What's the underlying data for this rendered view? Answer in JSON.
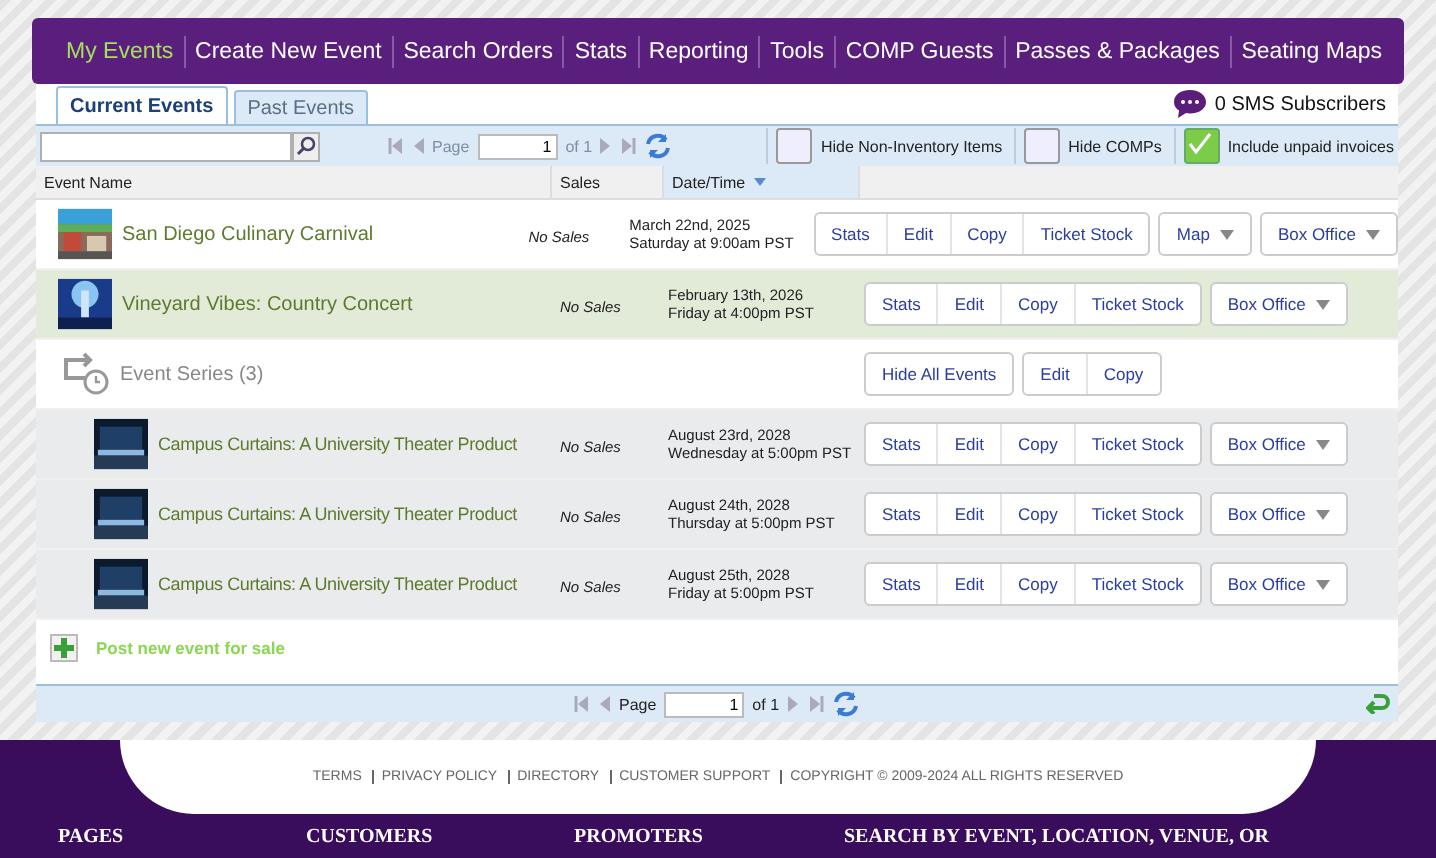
{
  "nav": [
    {
      "label": "My Events",
      "selected": true
    },
    {
      "label": "Create New Event",
      "selected": false
    },
    {
      "label": "Search Orders",
      "selected": false
    },
    {
      "label": "Stats",
      "selected": false
    },
    {
      "label": "Reporting",
      "selected": false
    },
    {
      "label": "Tools",
      "selected": false
    },
    {
      "label": "COMP Guests",
      "selected": false
    },
    {
      "label": "Passes & Packages",
      "selected": false
    },
    {
      "label": "Seating Maps",
      "selected": false
    }
  ],
  "tabs": [
    {
      "label": "Current Events",
      "selected": true
    },
    {
      "label": "Past Events",
      "selected": false
    }
  ],
  "sms": "0 SMS Subscribers",
  "toolbar": {
    "page_label": "Page",
    "page_value": "1",
    "page_of": "of 1",
    "options": [
      {
        "label": "Hide Non-Inventory Items",
        "checked": false
      },
      {
        "label": "Hide COMPs",
        "checked": false
      },
      {
        "label": "Include unpaid invoices",
        "checked": true
      }
    ]
  },
  "columns": [
    "Event Name",
    "Sales",
    "Date/Time"
  ],
  "rows": [
    {
      "kind": "event",
      "name": "San Diego Culinary Carnival",
      "sales": "No Sales",
      "date": "March 22nd, 2025",
      "time": "Saturday at 9:00am PST",
      "highlighted": false,
      "groups": [
        {
          "buttons": [
            "Stats",
            "Edit",
            "Copy",
            "Ticket Stock"
          ],
          "dropdown": false
        },
        {
          "buttons": [
            "Map"
          ],
          "dropdown": true
        },
        {
          "buttons": [
            "Box Office"
          ],
          "dropdown": true
        }
      ]
    },
    {
      "kind": "event",
      "name": "Vineyard Vibes: Country Concert",
      "sales": "No Sales",
      "date": "February 13th, 2026",
      "time": "Friday at 4:00pm PST",
      "highlighted": true,
      "groups": [
        {
          "buttons": [
            "Stats",
            "Edit",
            "Copy",
            "Ticket Stock"
          ],
          "dropdown": false
        },
        {
          "buttons": [
            "Box Office"
          ],
          "dropdown": true
        }
      ]
    },
    {
      "kind": "series",
      "name": "Event Series (3)",
      "highlighted": false,
      "groups": [
        {
          "buttons": [
            "Hide All Events"
          ],
          "dropdown": false
        },
        {
          "buttons": [
            "Edit",
            "Copy"
          ],
          "dropdown": false
        }
      ],
      "children": [
        {
          "kind": "event",
          "name": "Campus Curtains: A University Theater Product",
          "sales": "No Sales",
          "date": "August 23rd, 2028",
          "time": "Wednesday at 5:00pm PST",
          "highlighted": false,
          "groups": [
            {
              "buttons": [
                "Stats",
                "Edit",
                "Copy",
                "Ticket Stock"
              ],
              "dropdown": false
            },
            {
              "buttons": [
                "Box Office"
              ],
              "dropdown": true
            }
          ]
        },
        {
          "kind": "event",
          "name": "Campus Curtains: A University Theater Product",
          "sales": "No Sales",
          "date": "August 24th, 2028",
          "time": "Thursday at 5:00pm PST",
          "highlighted": false,
          "groups": [
            {
              "buttons": [
                "Stats",
                "Edit",
                "Copy",
                "Ticket Stock"
              ],
              "dropdown": false
            },
            {
              "buttons": [
                "Box Office"
              ],
              "dropdown": true
            }
          ]
        },
        {
          "kind": "event",
          "name": "Campus Curtains: A University Theater Product",
          "sales": "No Sales",
          "date": "August 25th, 2028",
          "time": "Friday at 5:00pm PST",
          "highlighted": false,
          "groups": [
            {
              "buttons": [
                "Stats",
                "Edit",
                "Copy",
                "Ticket Stock"
              ],
              "dropdown": false
            },
            {
              "buttons": [
                "Box Office"
              ],
              "dropdown": true
            }
          ]
        }
      ]
    }
  ],
  "post_link": "Post new event for sale",
  "pager": {
    "page_label": "Page",
    "page_value": "1",
    "page_of": "of 1"
  },
  "footer_links": [
    "TERMS",
    "PRIVACY POLICY",
    "DIRECTORY",
    "CUSTOMER SUPPORT",
    "COPYRIGHT © 2009-2024 ALL RIGHTS RESERVED"
  ],
  "footer_headings": [
    "PAGES",
    "CUSTOMERS",
    "PROMOTERS",
    "SEARCH BY EVENT, LOCATION, VENUE, OR"
  ]
}
